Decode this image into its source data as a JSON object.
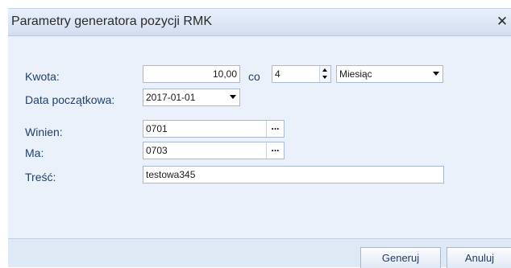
{
  "window": {
    "title": "Parametry generatora pozycji RMK",
    "close_glyph": "✕"
  },
  "form": {
    "kwota_label": "Kwota:",
    "kwota_value": "10,00",
    "co_label": "co",
    "interval_value": "4",
    "period_value": "Miesiąc",
    "start_date_label": "Data początkowa:",
    "start_date_value": "2017-01-01",
    "winien_label": "Winien:",
    "winien_value": "0701",
    "ma_label": "Ma:",
    "ma_value": "0703",
    "tresc_label": "Treść:",
    "tresc_value": "testowa345"
  },
  "buttons": {
    "ellipsis": "...",
    "generate": "Generuj",
    "cancel": "Anuluj"
  }
}
